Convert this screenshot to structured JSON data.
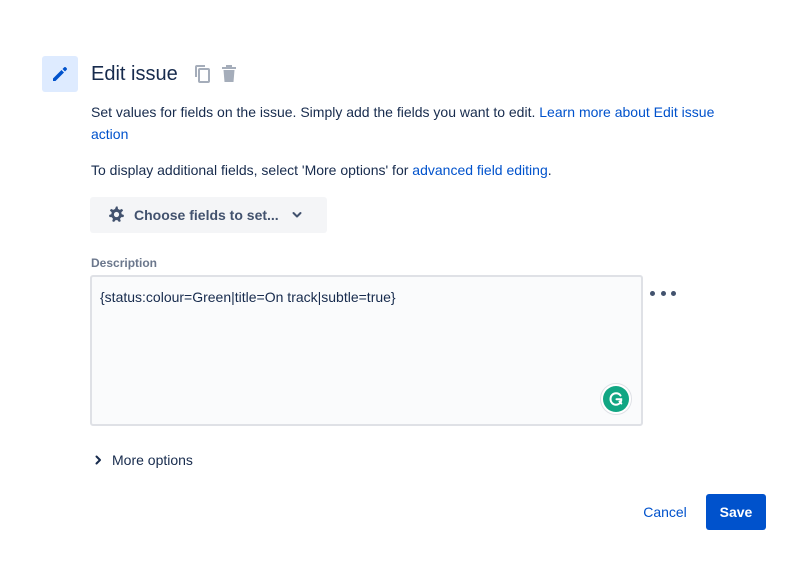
{
  "header": {
    "title": "Edit issue",
    "icon": "pencil-icon",
    "actions": [
      {
        "icon": "copy-icon"
      },
      {
        "icon": "trash-icon"
      }
    ]
  },
  "intro": {
    "text": "Set values for fields on the issue. Simply add the fields you want to edit. ",
    "link": "Learn more about Edit issue action"
  },
  "advanced": {
    "text_before": "To display additional fields, select 'More options' for ",
    "link": "advanced field editing",
    "text_after": "."
  },
  "choose_fields": {
    "label": "Choose fields to set...",
    "icon": "gear-icon",
    "chevron": "chevron-down-icon"
  },
  "description": {
    "label": "Description",
    "value": "{status:colour=Green|title=On track|subtle=true}",
    "more_icon": "more-horizontal-icon",
    "grammarly_icon": "grammarly-icon"
  },
  "more_options": {
    "label": "More options",
    "icon": "chevron-right-icon"
  },
  "footer": {
    "cancel_label": "Cancel",
    "save_label": "Save"
  },
  "colors": {
    "primary": "#0052cc",
    "text": "#172b4d",
    "subtle": "#42526e",
    "icon_bg": "#deebff"
  }
}
